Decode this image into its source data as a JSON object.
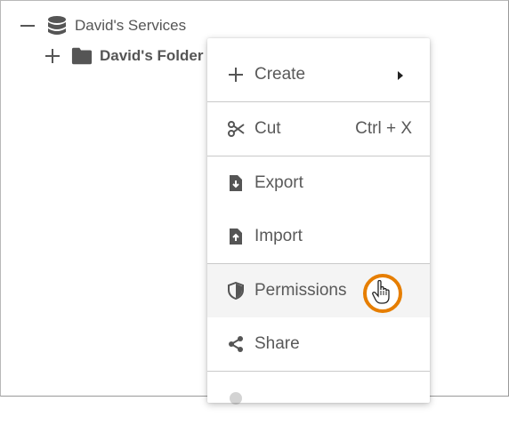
{
  "tree": {
    "root": {
      "label": "David's Services",
      "toggle": "collapse",
      "icon": "database-icon"
    },
    "child": {
      "label": "David's Folder",
      "toggle": "expand",
      "icon": "folder-icon"
    }
  },
  "context_menu": {
    "items": [
      {
        "label": "Create",
        "icon": "plus-icon",
        "submenu": true
      },
      {
        "label": "Cut",
        "icon": "scissors-icon",
        "shortcut": "Ctrl + X"
      },
      {
        "label": "Export",
        "icon": "file-export-icon"
      },
      {
        "label": "Import",
        "icon": "file-import-icon"
      },
      {
        "label": "Permissions",
        "icon": "shield-icon",
        "hovered": true
      },
      {
        "label": "Share",
        "icon": "share-icon"
      }
    ]
  },
  "colors": {
    "highlight_ring": "#e67e00",
    "text": "#595959",
    "hover_bg": "#f4f4f4"
  }
}
